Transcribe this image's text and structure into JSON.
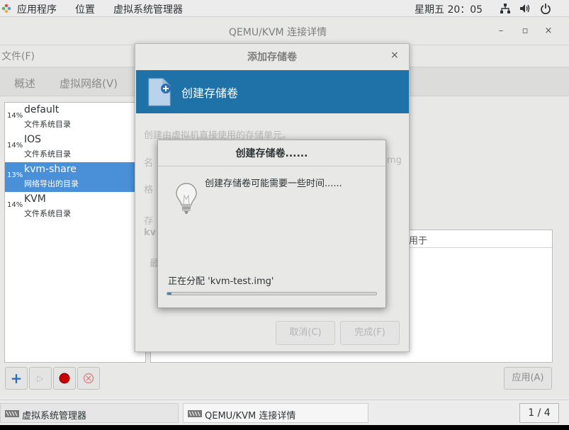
{
  "top_panel": {
    "applications": "应用程序",
    "places": "位置",
    "app_name": "虚拟系统管理器",
    "clock": "星期五 20：05",
    "icons": [
      "network-icon",
      "volume-icon",
      "power-icon"
    ]
  },
  "main_window": {
    "title": "QEMU/KVM 连接详情",
    "controls": {
      "minimize": "–",
      "maximize": "▫",
      "close": "×"
    },
    "menu": {
      "file": "文件(F)"
    },
    "tabs": [
      "概述",
      "虚拟网络(V)"
    ],
    "pools": [
      {
        "pct": "14%",
        "name": "default",
        "type": "文件系统目录"
      },
      {
        "pct": "14%",
        "name": "IOS",
        "type": "文件系统目录"
      },
      {
        "pct": "13%",
        "name": "kvm-share",
        "type": "网络导出的目录",
        "selected": true
      },
      {
        "pct": "14%",
        "name": "KVM",
        "type": "文件系统目录"
      }
    ],
    "volume_columns": {
      "used_by": "用于"
    },
    "apply_label": "应用(A)"
  },
  "add_volume_dialog": {
    "title": "添加存储卷",
    "close": "×",
    "heading": "创建存储卷",
    "description": "创建由虚拟机直接使用的存储单元。",
    "faded_name": "名",
    "faded_img": "mg",
    "faded_format": "格",
    "faded_storage": "存",
    "faded_kvm": "kv",
    "faded_max": "最",
    "cancel_label": "取消(C)",
    "finish_label": "完成(F)"
  },
  "progress_dialog": {
    "title": "创建存储卷......",
    "message": "创建存储卷可能需要一些时间......",
    "status": "正在分配 'kvm-test.img'",
    "progress": 0.02
  },
  "taskbar": {
    "items": [
      "虚拟系统管理器",
      "QEMU/KVM 连接详情"
    ],
    "workspace": "1 / 4"
  },
  "colors": {
    "header_blue": "#1e72a8",
    "selection_blue": "#4a90d9",
    "stop_red": "#cc0000"
  }
}
